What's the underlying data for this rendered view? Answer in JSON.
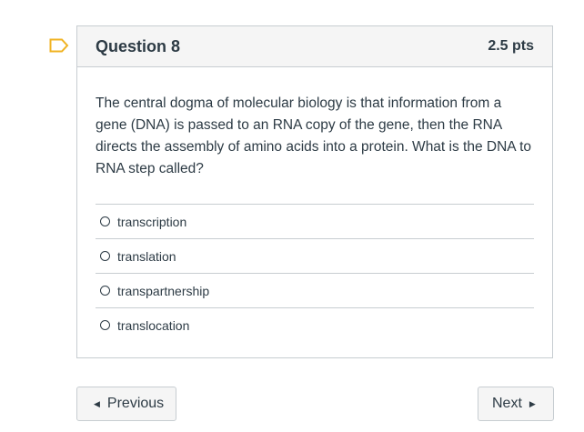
{
  "question": {
    "title": "Question 8",
    "points": "2.5 pts",
    "text": "The central dogma of molecular biology is that information from a gene (DNA) is passed to an RNA copy of the gene, then the RNA directs the assembly of amino acids into a protein. What is the DNA to RNA step called?",
    "flag_icon": "flag-icon",
    "accent_color": "#f0b323",
    "answers": [
      {
        "label": "transcription",
        "selected": false
      },
      {
        "label": "translation",
        "selected": false
      },
      {
        "label": "transpartnership",
        "selected": false
      },
      {
        "label": "translocation",
        "selected": false
      }
    ]
  },
  "navigation": {
    "previous_label": "Previous",
    "next_label": "Next",
    "previous_icon": "caret-left-icon",
    "next_icon": "caret-right-icon"
  }
}
